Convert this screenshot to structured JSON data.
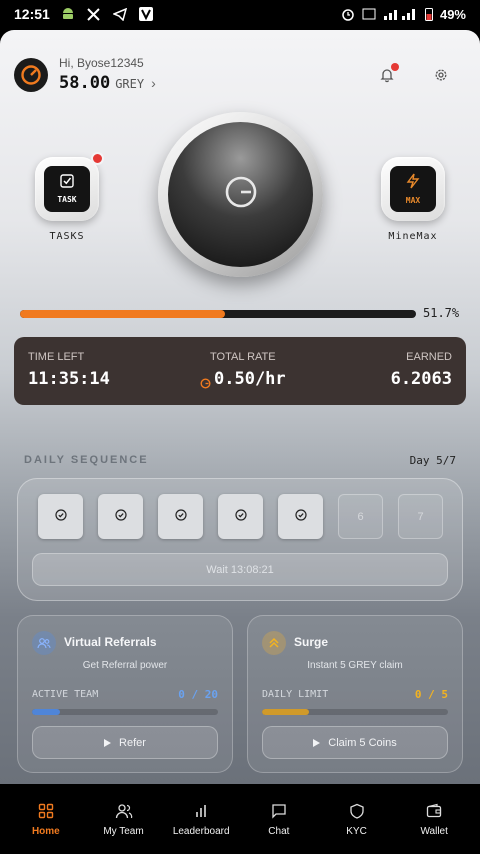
{
  "status_bar": {
    "time": "12:51",
    "battery": "49%",
    "notification_icons": [
      "android-icon",
      "x-icon",
      "telegram-icon",
      "v-app-icon"
    ],
    "system_icons": [
      "alarm-icon",
      "volte-icon",
      "signal-icon",
      "battery-icon"
    ]
  },
  "header": {
    "greeting": "Hi, Byose12345",
    "balance": "58.00",
    "currency": "GREY",
    "chevron": "›"
  },
  "tasks": {
    "label": "TASKS",
    "icon_text": "TASK"
  },
  "minemax": {
    "label": "MineMax",
    "icon_text": "MAX"
  },
  "progress": {
    "text": "51.7%",
    "fraction": 0.517
  },
  "stats": {
    "time_left_label": "TIME LEFT",
    "time_left": "11:35:14",
    "total_rate_label": "TOTAL RATE",
    "total_rate": "0.50/hr",
    "earned_label": "EARNED",
    "earned": "6.2063"
  },
  "daily_sequence": {
    "title": "DAILY SEQUENCE",
    "day": "Day 5/7",
    "days": [
      {
        "label": "",
        "done": true
      },
      {
        "label": "",
        "done": true
      },
      {
        "label": "",
        "done": true
      },
      {
        "label": "",
        "done": true
      },
      {
        "label": "",
        "done": true
      },
      {
        "label": "6",
        "done": false
      },
      {
        "label": "7",
        "done": false
      }
    ],
    "wait_label": "Wait 13:08:21"
  },
  "referrals": {
    "title": "Virtual Referrals",
    "subtitle": "Get Referral power",
    "stat_label": "ACTIVE TEAM",
    "stat_value": "0 / 20",
    "fill_fraction": 0.15,
    "button": "Refer"
  },
  "surge": {
    "title": "Surge",
    "subtitle": "Instant 5 GREY claim",
    "stat_label": "DAILY LIMIT",
    "stat_value": "0 / 5",
    "fill_fraction": 0.25,
    "button": "Claim 5 Coins"
  },
  "nav": {
    "items": [
      {
        "label": "Home",
        "icon": "home-grid-icon",
        "active": true
      },
      {
        "label": "My Team",
        "icon": "team-icon",
        "active": false
      },
      {
        "label": "Leaderboard",
        "icon": "leaderboard-icon",
        "active": false
      },
      {
        "label": "Chat",
        "icon": "chat-icon",
        "active": false
      },
      {
        "label": "KYC",
        "icon": "shield-icon",
        "active": false
      },
      {
        "label": "Wallet",
        "icon": "wallet-icon",
        "active": false
      }
    ]
  },
  "colors": {
    "accent": "#f07a1f",
    "stats_bg": "#3c3331",
    "referral_blue": "#6aa2f0",
    "surge_gold": "#f3b320",
    "notification_red": "#e53935"
  }
}
